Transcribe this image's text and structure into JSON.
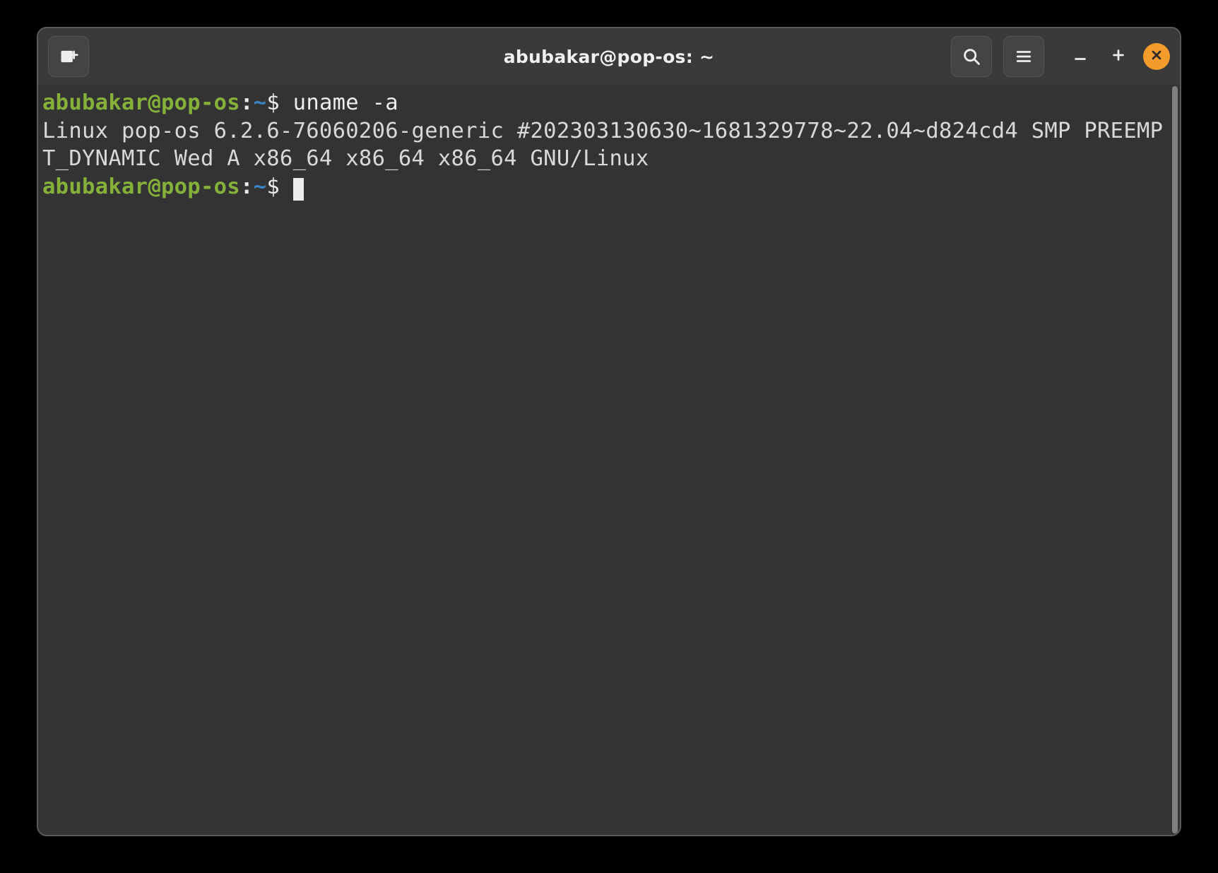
{
  "window": {
    "title": "abubakar@pop-os: ~"
  },
  "prompt": {
    "user": "abubakar",
    "at": "@",
    "host": "pop-os",
    "colon": ":",
    "cwd": "~",
    "sigil": "$"
  },
  "session": {
    "command": "uname -a",
    "output": "Linux pop-os 6.2.6-76060206-generic #202303130630~1681329778~22.04~d824cd4 SMP PREEMPT_DYNAMIC Wed A x86_64 x86_64 x86_64 GNU/Linux"
  },
  "icons": {
    "new_tab": "new-tab",
    "search": "search",
    "menu": "menu",
    "minimize": "minimize",
    "maximize": "maximize",
    "close": "close"
  }
}
